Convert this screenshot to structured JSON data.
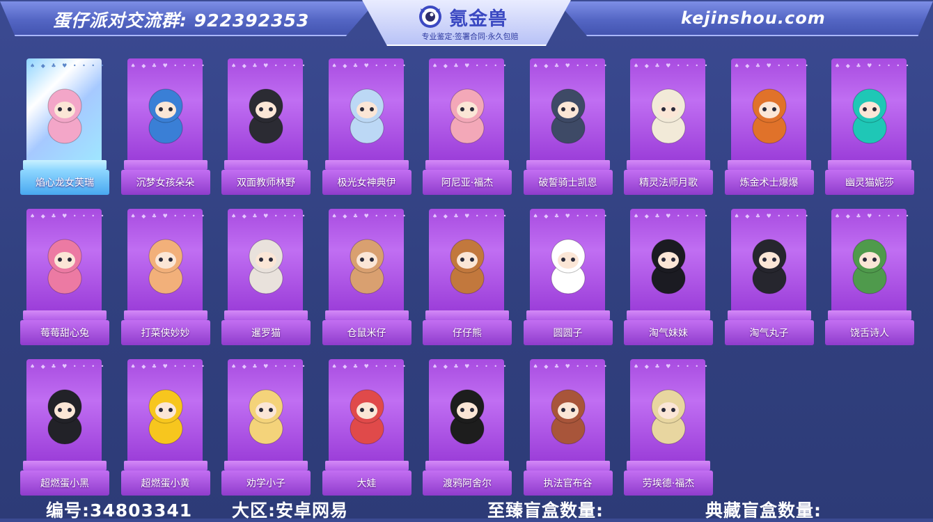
{
  "header": {
    "group_label": "蛋仔派对交流群: 922392353",
    "logo_text": "氪金兽",
    "logo_subtitle": "专业鉴定·签署合同·永久包赔",
    "site_url": "kejinshou.com"
  },
  "cards": [
    {
      "name": "焰心龙女芙瑞",
      "highlighted": true,
      "color": "#f3a6c8"
    },
    {
      "name": "沉梦女孩朵朵",
      "highlighted": false,
      "color": "#3a7fd6"
    },
    {
      "name": "双面教师林野",
      "highlighted": false,
      "color": "#2b2b33"
    },
    {
      "name": "极光女神典伊",
      "highlighted": false,
      "color": "#bcd8f5"
    },
    {
      "name": "阿尼亚·福杰",
      "highlighted": false,
      "color": "#f3a8b8"
    },
    {
      "name": "破誓骑士凯恩",
      "highlighted": false,
      "color": "#3e4a66"
    },
    {
      "name": "精灵法师月歌",
      "highlighted": false,
      "color": "#f2ead8"
    },
    {
      "name": "炼金术士爆爆",
      "highlighted": false,
      "color": "#e0722a"
    },
    {
      "name": "幽灵猫妮莎",
      "highlighted": false,
      "color": "#1fc7b6"
    },
    {
      "name": "莓莓甜心兔",
      "highlighted": false,
      "color": "#ec7aa3"
    },
    {
      "name": "打菜侠妙妙",
      "highlighted": false,
      "color": "#f2b07a"
    },
    {
      "name": "暹罗猫",
      "highlighted": false,
      "color": "#e9e2dc"
    },
    {
      "name": "仓鼠米仔",
      "highlighted": false,
      "color": "#d9a070"
    },
    {
      "name": "仔仔熊",
      "highlighted": false,
      "color": "#c2783d"
    },
    {
      "name": "圆圆子",
      "highlighted": false,
      "color": "#ffffff"
    },
    {
      "name": "淘气妹妹",
      "highlighted": false,
      "color": "#1b1b22"
    },
    {
      "name": "淘气丸子",
      "highlighted": false,
      "color": "#26262e"
    },
    {
      "name": "饶舌诗人",
      "highlighted": false,
      "color": "#4f9a4c"
    },
    {
      "name": "超燃蛋小黑",
      "highlighted": false,
      "color": "#222228"
    },
    {
      "name": "超燃蛋小黄",
      "highlighted": false,
      "color": "#f7c61e"
    },
    {
      "name": "劝学小子",
      "highlighted": false,
      "color": "#f4d37a"
    },
    {
      "name": "大娃",
      "highlighted": false,
      "color": "#e04a4a"
    },
    {
      "name": "渡鸦阿舍尔",
      "highlighted": false,
      "color": "#1d1d1d"
    },
    {
      "name": "执法官布谷",
      "highlighted": false,
      "color": "#a8553a"
    },
    {
      "name": "劳埃德·福杰",
      "highlighted": false,
      "color": "#e8d6a0"
    }
  ],
  "footer": {
    "id_text": "编号:34803341",
    "region_text": "大区:安卓网易",
    "supreme_box_text": "至臻盲盒数量:",
    "collection_box_text": "典藏盲盒数量:"
  }
}
